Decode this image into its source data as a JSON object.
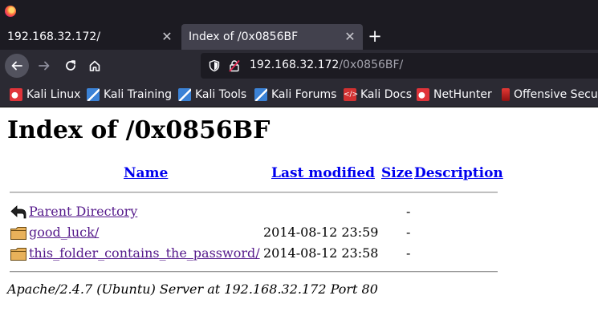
{
  "browser": {
    "tabs": [
      {
        "title": "192.168.32.172/",
        "close": "✕"
      },
      {
        "title": "Index of /0x0856BF",
        "close": "✕"
      }
    ],
    "new_tab": "+",
    "url": {
      "host": "192.168.32.172",
      "path": "/0x0856BF/"
    },
    "bookmarks": [
      {
        "label": "Kali Linux",
        "icon": "kali-dragon-icon"
      },
      {
        "label": "Kali Training",
        "icon": "kali-training-icon"
      },
      {
        "label": "Kali Tools",
        "icon": "kali-tools-icon"
      },
      {
        "label": "Kali Forums",
        "icon": "kali-forums-icon"
      },
      {
        "label": "Kali Docs",
        "icon": "kali-docs-icon"
      },
      {
        "label": "NetHunter",
        "icon": "nethunter-icon"
      },
      {
        "label": "Offensive Security",
        "icon": "offsec-icon"
      }
    ]
  },
  "page": {
    "title": "Index of /0x0856BF",
    "columns": {
      "name": "Name",
      "last_modified": "Last modified",
      "size": "Size",
      "description": "Description"
    },
    "rows": [
      {
        "name": "Parent Directory",
        "date": "",
        "size": "-",
        "icon": "back-arrow-icon"
      },
      {
        "name": "good_luck/",
        "date": "2014-08-12 23:59",
        "size": "-",
        "icon": "folder-icon"
      },
      {
        "name": "this_folder_contains_the_password/",
        "date": "2014-08-12 23:58",
        "size": "-",
        "icon": "folder-icon"
      }
    ],
    "footer": "Apache/2.4.7 (Ubuntu) Server at 192.168.32.172 Port 80"
  },
  "colors": {
    "link": "#0000ee",
    "visited": "#551a8b",
    "chrome_dark": "#1c1b22",
    "toolbar": "#2b2a33",
    "active_tab": "#42414d"
  }
}
